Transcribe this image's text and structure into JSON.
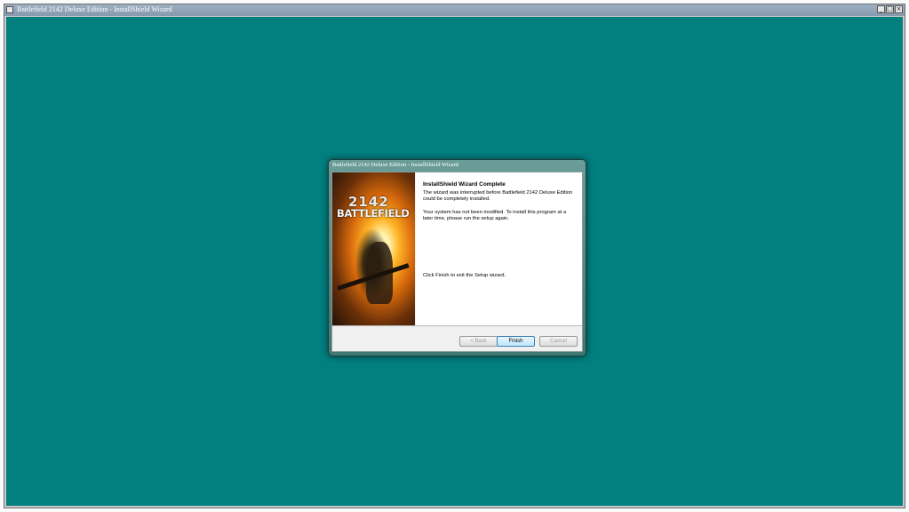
{
  "outer_window": {
    "title": "Battlefield 2142 Deluxe Edition - InstallShield Wizard",
    "controls": {
      "minimize": "_",
      "maximize": "□",
      "close": "×"
    }
  },
  "dialog": {
    "title": "Battlefield 2142 Deluxe Edition - InstallShield Wizard",
    "banner": {
      "logo_number": "2142",
      "logo_text": "BATTLEFIELD"
    },
    "heading": "InstallShield Wizard Complete",
    "message_1": "The wizard was interrupted before Battlefield 2142 Deluxe Edition could be completely installed.",
    "message_2": "Your system has not been modified. To install this program at a later time, please run the setup again.",
    "message_3": "Click Finish to exit the Setup wizard.",
    "buttons": {
      "back": "< Back",
      "finish": "Finish",
      "cancel": "Cancel"
    }
  },
  "colors": {
    "desktop": "#027f7f",
    "dialog_frame": "#3f7873"
  }
}
